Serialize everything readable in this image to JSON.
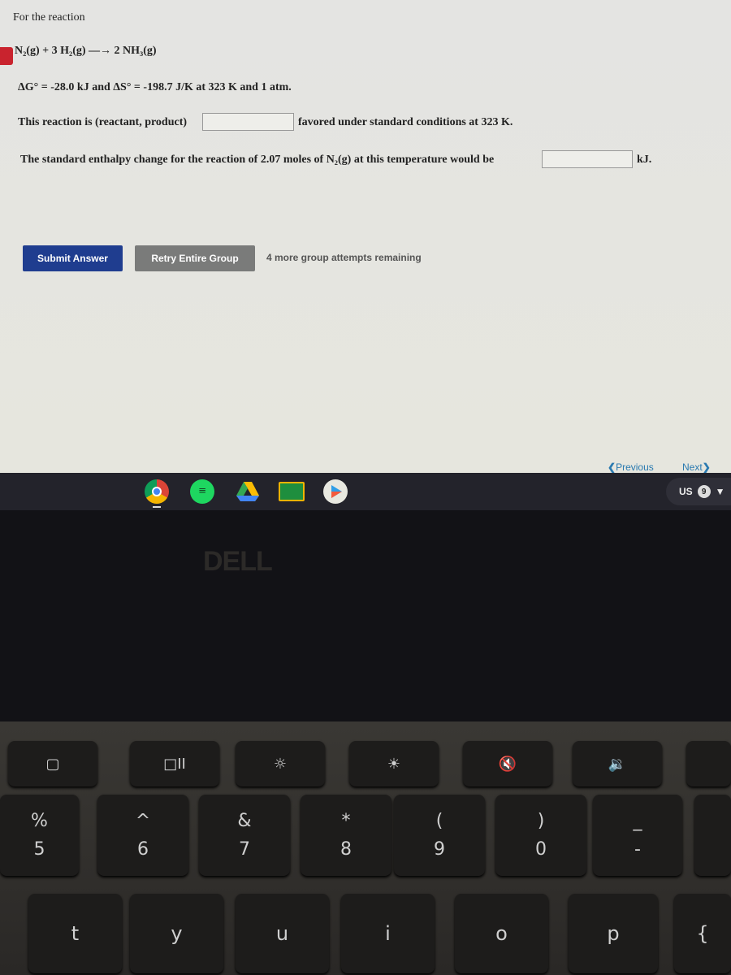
{
  "question": {
    "intro": "For the reaction",
    "equation": "N₂(g) + 3 H₂(g) —→ 2 NH₃(g)",
    "conditions": "ΔG° = -28.0 kJ and ΔS° = -198.7 J/K at 323 K and 1 atm.",
    "q1_before": "This reaction is (reactant, product)",
    "q1_value": "",
    "q1_after": "favored under standard conditions at 323 K.",
    "q2_before": "The standard enthalpy change for the reaction of 2.07 moles of N₂(g) at this temperature would be",
    "q2_value": "",
    "q2_after": "kJ."
  },
  "actions": {
    "submit": "Submit Answer",
    "retry": "Retry Entire Group",
    "attempts": "4 more group attempts remaining"
  },
  "nav": {
    "previous": "Previous",
    "next": "Next"
  },
  "shelf": {
    "apps": [
      "chrome-icon",
      "spotify-icon",
      "google-drive-icon",
      "google-classroom-icon",
      "play-store-icon"
    ],
    "locale": "US",
    "notifications": "9"
  },
  "brand": "DELL",
  "keyboard": {
    "function_row": [
      "▢",
      "□II",
      "☼",
      "☀",
      "🔇",
      "🔉"
    ],
    "number_row": [
      {
        "top": "%",
        "bottom": "5"
      },
      {
        "top": "^",
        "bottom": "6"
      },
      {
        "top": "&",
        "bottom": "7"
      },
      {
        "top": "*",
        "bottom": "8"
      },
      {
        "top": "(",
        "bottom": "9"
      },
      {
        "top": ")",
        "bottom": "0"
      },
      {
        "top": "_",
        "bottom": "-"
      }
    ],
    "letter_row": [
      "t",
      "y",
      "u",
      "i",
      "o",
      "p",
      "{"
    ]
  },
  "colors": {
    "submit": "#1f3d8f",
    "retry": "#7a7b7a",
    "link": "#2a7ab0"
  }
}
